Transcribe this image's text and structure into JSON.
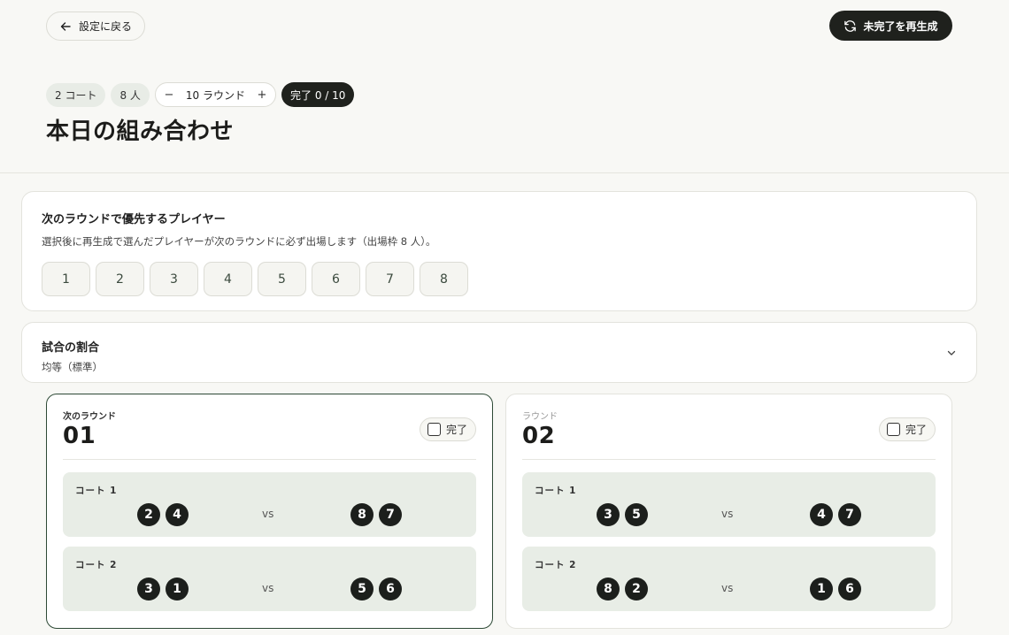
{
  "header": {
    "back_label": "設定に戻る",
    "regenerate_label": "未完了を再生成",
    "chips": {
      "courts": "2 コート",
      "players": "8 人"
    },
    "rounds_stepper": {
      "minus": "−",
      "value": "10 ラウンド",
      "plus": "+"
    },
    "progress": "完了 0 / 10",
    "title": "本日の組み合わせ"
  },
  "priority": {
    "title": "次のラウンドで優先するプレイヤー",
    "description": "選択後に再生成で選んだプレイヤーが次のラウンドに必ず出場します（出場枠 8 人）。",
    "players": [
      "1",
      "2",
      "3",
      "4",
      "5",
      "6",
      "7",
      "8"
    ]
  },
  "ratio": {
    "title": "試合の割合",
    "value": "均等（標準）"
  },
  "rounds": [
    {
      "label": "次のラウンド",
      "number": "01",
      "done_label": "完了",
      "courts": [
        {
          "label": "コート 1",
          "team_a": [
            "2",
            "4"
          ],
          "vs": "vs",
          "team_b": [
            "8",
            "7"
          ]
        },
        {
          "label": "コート 2",
          "team_a": [
            "3",
            "1"
          ],
          "vs": "vs",
          "team_b": [
            "5",
            "6"
          ]
        }
      ]
    },
    {
      "label": "ラウンド",
      "number": "02",
      "done_label": "完了",
      "courts": [
        {
          "label": "コート 1",
          "team_a": [
            "3",
            "5"
          ],
          "vs": "vs",
          "team_b": [
            "4",
            "7"
          ]
        },
        {
          "label": "コート 2",
          "team_a": [
            "8",
            "2"
          ],
          "vs": "vs",
          "team_b": [
            "1",
            "6"
          ]
        }
      ]
    }
  ]
}
